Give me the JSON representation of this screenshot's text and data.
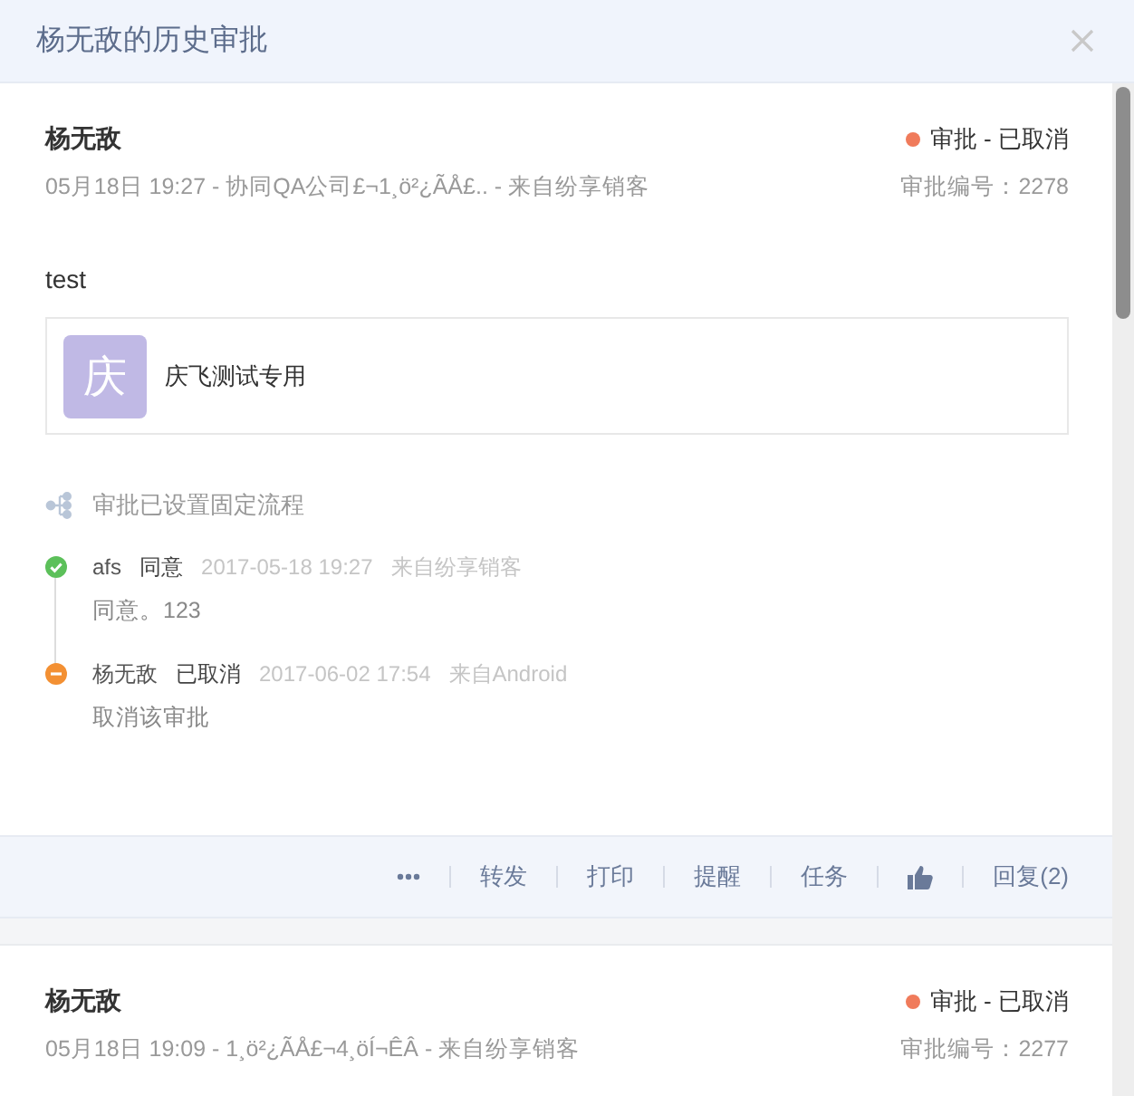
{
  "dialog": {
    "title": "杨无敌的历史审批"
  },
  "records": [
    {
      "author": "杨无敌",
      "meta": "05月18日 19:27 - 协同QA公司£¬1¸ö²¿ÃÅ£.. - 来自纷享销客",
      "status": "审批 - 已取消",
      "color": "#f07b5b",
      "number": "审批编号：2278",
      "body": "test",
      "attachment": {
        "initial": "庆",
        "name": "庆飞测试专用"
      },
      "flow_note": "审批已设置固定流程",
      "steps": [
        {
          "kind": "approved",
          "name": "afs",
          "action": "同意",
          "time": "2017-05-18 19:27",
          "source": "来自纷享销客",
          "comment": "同意。123"
        },
        {
          "kind": "cancelled",
          "name": "杨无敌",
          "action": "已取消",
          "time": "2017-06-02 17:54",
          "source": "来自Android",
          "comment": "取消该审批"
        }
      ],
      "actions": [
        {
          "kind": "more"
        },
        {
          "kind": "text",
          "label": "转发"
        },
        {
          "kind": "text",
          "label": "打印"
        },
        {
          "kind": "text",
          "label": "提醒"
        },
        {
          "kind": "text",
          "label": "任务"
        },
        {
          "kind": "like"
        },
        {
          "kind": "text",
          "label": "回复(2)"
        }
      ]
    },
    {
      "author": "杨无敌",
      "meta": "05月18日 19:09 - 1¸ö²¿ÃÅ£¬4¸öÍ¬ÊÂ - 来自纷享销客",
      "status": "审批 - 已取消",
      "color": "#f07b5b",
      "number": "审批编号：2277"
    }
  ]
}
